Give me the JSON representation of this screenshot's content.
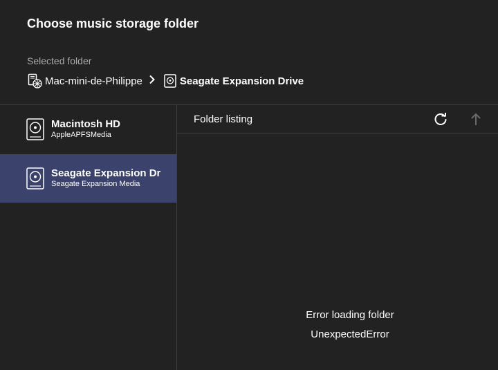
{
  "dialog": {
    "title": "Choose music storage folder",
    "selected_folder_label": "Selected folder"
  },
  "breadcrumb": {
    "items": [
      {
        "label": "Mac-mini-de-Philippe",
        "icon": "network-computer-icon"
      },
      {
        "label": "Seagate Expansion Drive",
        "icon": "hard-drive-icon"
      }
    ],
    "separator_icon": "chevron-right-icon"
  },
  "sidebar": {
    "drives": [
      {
        "name": "Macintosh HD",
        "media": "AppleAPFSMedia",
        "selected": false,
        "icon": "hard-drive-icon"
      },
      {
        "name": "Seagate Expansion Drive",
        "media": "Seagate Expansion Media",
        "selected": true,
        "icon": "hard-drive-icon"
      }
    ],
    "selected_color": "#3b426b"
  },
  "listing": {
    "title": "Folder listing",
    "refresh_icon": "refresh-icon",
    "up_icon": "arrow-up-icon",
    "error_title": "Error loading folder",
    "error_detail": "UnexpectedError"
  },
  "colors": {
    "background": "#222222",
    "divider": "#3e3e3e",
    "muted_text": "#a9a9a9",
    "disabled_icon": "#6a6a6a"
  }
}
